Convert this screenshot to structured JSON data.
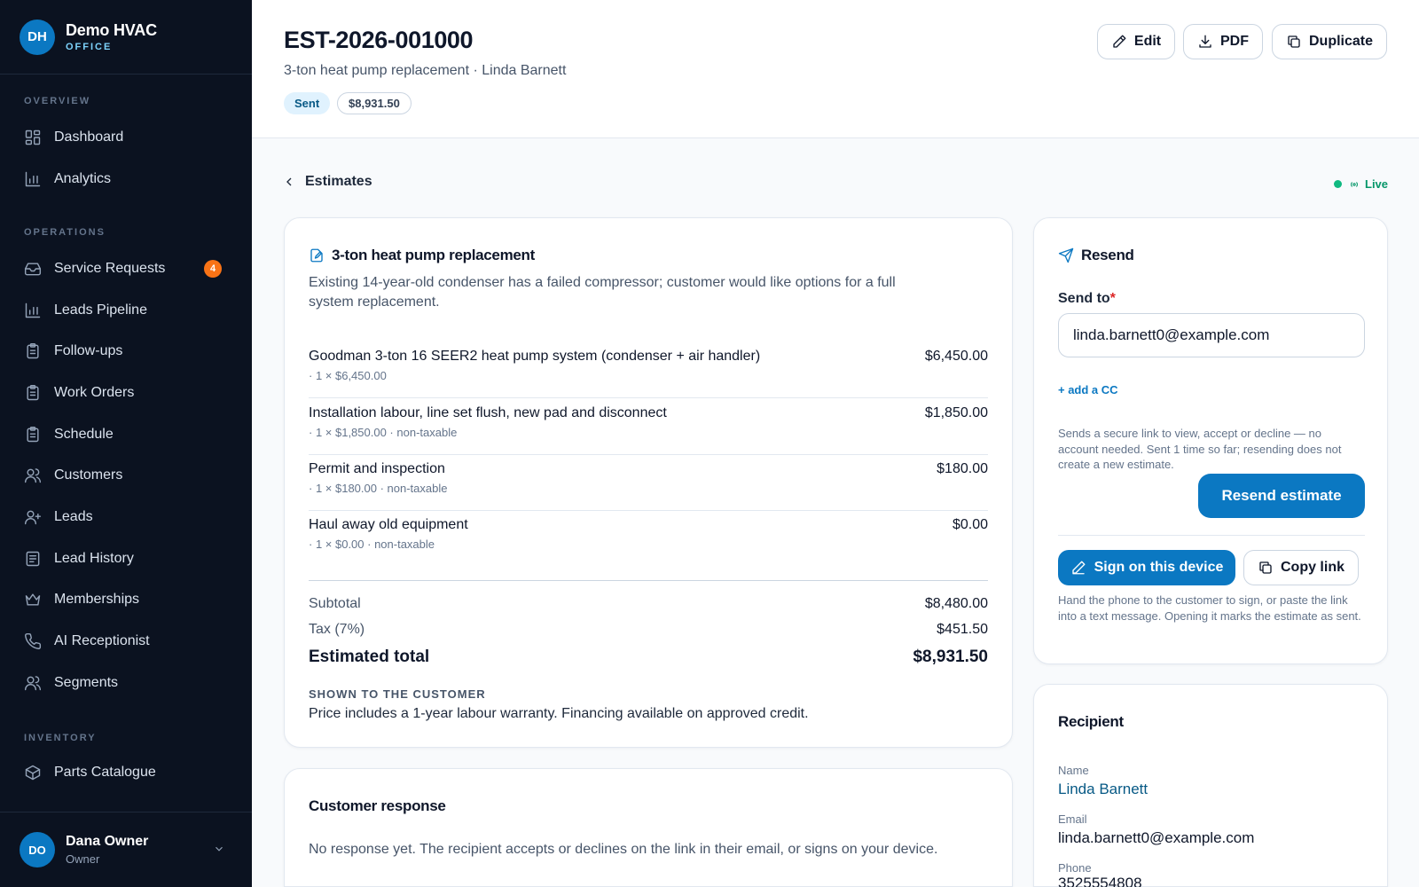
{
  "brand": {
    "initials": "DH",
    "name": "Demo HVAC",
    "sub": "OFFICE"
  },
  "nav": {
    "overview_label": "OVERVIEW",
    "operations_label": "OPERATIONS",
    "inventory_label": "INVENTORY",
    "items": [
      {
        "label": "Dashboard",
        "icon": "dashboard-icon"
      },
      {
        "label": "Analytics",
        "icon": "bar-chart-icon"
      },
      {
        "label": "Service Requests",
        "icon": "inbox-icon",
        "badge": "4"
      },
      {
        "label": "Leads Pipeline",
        "icon": "bar-chart-icon"
      },
      {
        "label": "Follow-ups",
        "icon": "clipboard-icon"
      },
      {
        "label": "Work Orders",
        "icon": "clipboard-icon"
      },
      {
        "label": "Schedule",
        "icon": "clipboard-icon"
      },
      {
        "label": "Customers",
        "icon": "users-icon"
      },
      {
        "label": "Leads",
        "icon": "user-plus-icon"
      },
      {
        "label": "Lead History",
        "icon": "history-icon"
      },
      {
        "label": "Memberships",
        "icon": "crown-icon"
      },
      {
        "label": "AI Receptionist",
        "icon": "phone-icon"
      },
      {
        "label": "Segments",
        "icon": "users-icon"
      },
      {
        "label": "Parts Catalogue",
        "icon": "box-icon"
      }
    ]
  },
  "user": {
    "initials": "DO",
    "name": "Dana Owner",
    "role": "Owner"
  },
  "header": {
    "estimate_number": "EST-2026-001000",
    "subtitle": "3-ton heat pump replacement · Linda Barnett",
    "status": "Sent",
    "amount": "$8,931.50",
    "buttons": {
      "edit": "Edit",
      "pdf": "PDF",
      "duplicate": "Duplicate"
    }
  },
  "back_label": "Estimates",
  "live_label": "Live",
  "estimate": {
    "title": "3-ton heat pump replacement",
    "description": "Existing 14-year-old condenser has a failed compressor; customer would like options for a full system replacement.",
    "line_items": [
      {
        "name": "Goodman 3-ton 16 SEER2 heat pump system (condenser + air handler)",
        "meta": "· 1 × $6,450.00",
        "amount": "$6,450.00"
      },
      {
        "name": "Installation labour, line set flush, new pad and disconnect",
        "meta": "· 1 × $1,850.00 · non-taxable",
        "amount": "$1,850.00"
      },
      {
        "name": "Permit and inspection",
        "meta": "· 1 × $180.00 · non-taxable",
        "amount": "$180.00"
      },
      {
        "name": "Haul away old equipment",
        "meta": "· 1 × $0.00 · non-taxable",
        "amount": "$0.00"
      }
    ],
    "subtotal_label": "Subtotal",
    "subtotal": "$8,480.00",
    "tax_label": "Tax (7%)",
    "tax": "$451.50",
    "total_label": "Estimated total",
    "total": "$8,931.50",
    "shown_label": "SHOWN TO THE CUSTOMER",
    "shown_text": "Price includes a 1-year labour warranty. Financing available on approved credit."
  },
  "customer_response": {
    "title": "Customer response",
    "text": "No response yet. The recipient accepts or declines on the link in their email, or signs on your device."
  },
  "resend": {
    "title": "Resend",
    "send_to_label": "Send to",
    "required_mark": "*",
    "email_value": "linda.barnett0@example.com",
    "add_cc": "+ add a CC",
    "note": "Sends a secure link to view, accept or decline — no account needed. Sent 1 time so far; resending does not create a new estimate.",
    "resend_button": "Resend estimate",
    "sign_button": "Sign on this device",
    "copy_button": "Copy link",
    "sign_note": "Hand the phone to the customer to sign, or paste the link into a text message. Opening it marks the estimate as sent."
  },
  "recipient": {
    "title": "Recipient",
    "name_label": "Name",
    "name": "Linda Barnett",
    "email_label": "Email",
    "email": "linda.barnett0@example.com",
    "phone_label": "Phone",
    "phone": "3525554808"
  },
  "colors": {
    "accent": "#0b78c2",
    "sidebar": "#0b1220",
    "badge": "#f97316",
    "live": "#10b981"
  }
}
